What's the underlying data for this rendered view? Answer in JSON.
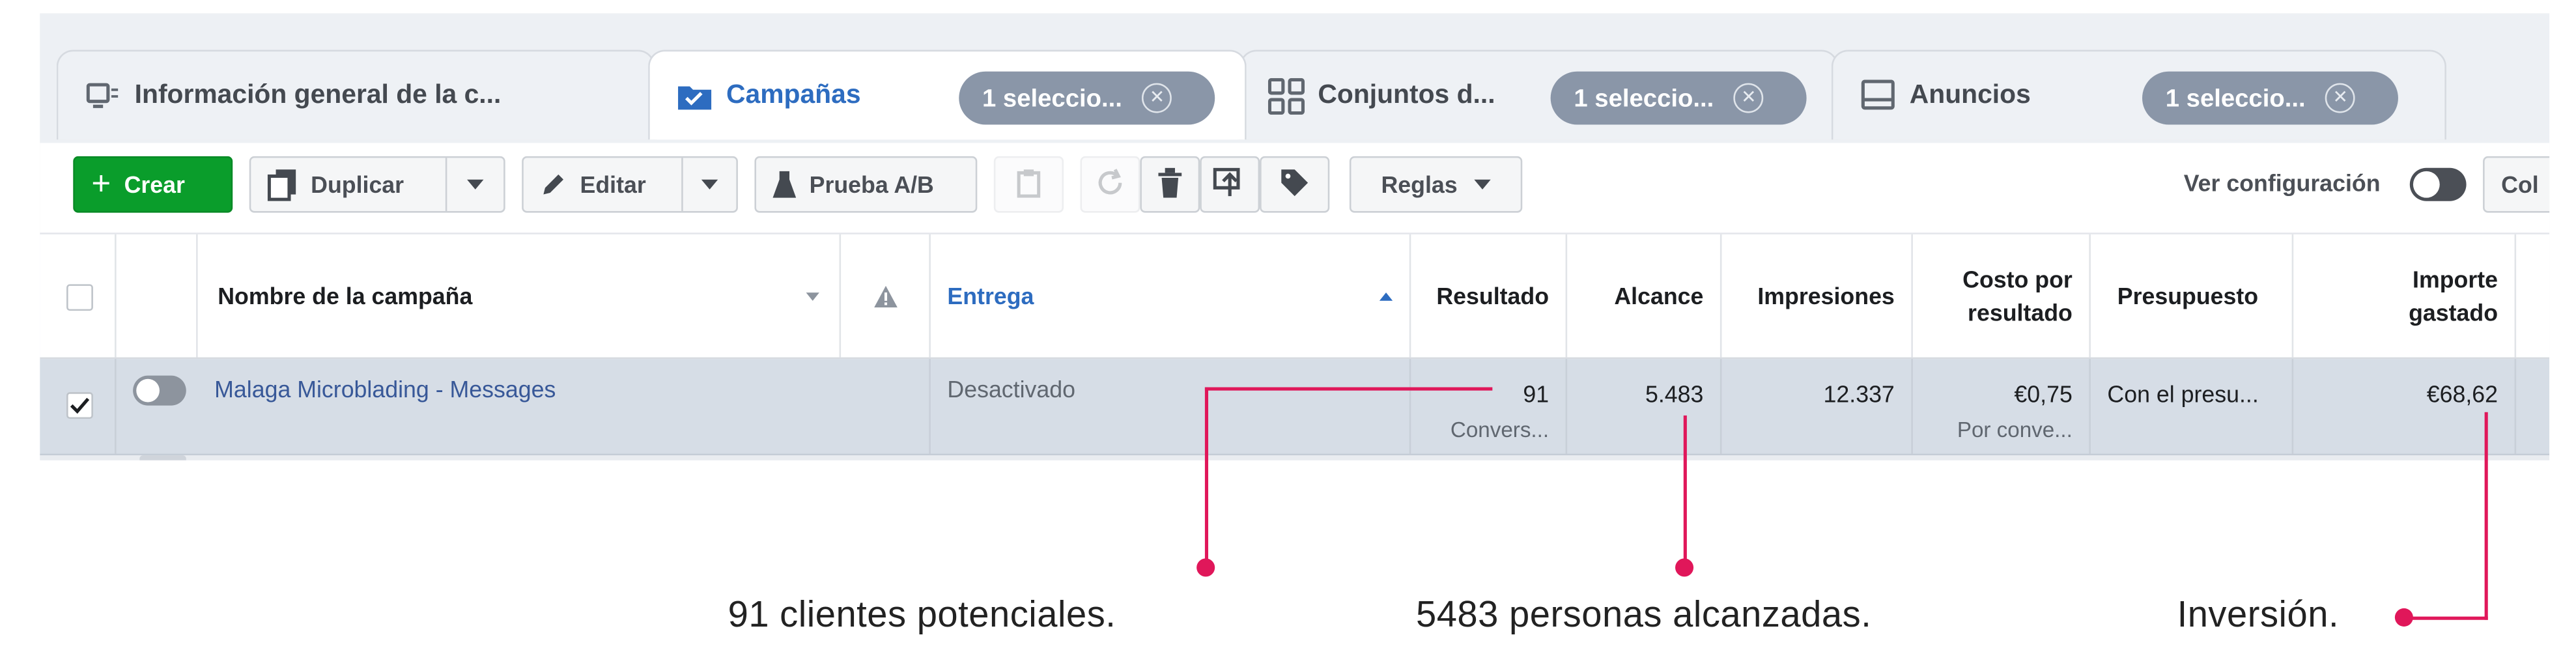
{
  "tabs": [
    {
      "label": "Información general de la c...",
      "icon": "overview-icon"
    },
    {
      "label": "Campañas",
      "icon": "folder-icon",
      "selection": "1 seleccio..."
    },
    {
      "label": "Conjuntos d...",
      "icon": "grid-icon",
      "selection": "1 seleccio..."
    },
    {
      "label": "Anuncios",
      "icon": "ad-icon",
      "selection": "1 seleccio..."
    }
  ],
  "toolbar": {
    "create": "Crear",
    "duplicate": "Duplicar",
    "edit": "Editar",
    "ab_test": "Prueba A/B",
    "rules": "Reglas",
    "view_settings": "Ver configuración",
    "columns": "Col"
  },
  "table": {
    "headers": {
      "name": "Nombre de la campaña",
      "delivery": "Entrega",
      "result": "Resultado",
      "reach": "Alcance",
      "impressions": "Impresiones",
      "cost_per_result_1": "Costo por",
      "cost_per_result_2": "resultado",
      "budget": "Presupuesto",
      "amount_spent_1": "Importe",
      "amount_spent_2": "gastado"
    },
    "rows": [
      {
        "name": "Malaga Microblading - Messages",
        "delivery": "Desactivado",
        "result": "91",
        "result_sub": "Convers...",
        "reach": "5.483",
        "impressions": "12.337",
        "cost": "€0,75",
        "cost_sub": "Por conve...",
        "budget": "Con el presu...",
        "spent": "€68,62"
      }
    ]
  },
  "annotations": {
    "leads": "91 clientes potenciales.",
    "reach": "5483 personas alcanzadas.",
    "investment": "Inversión."
  },
  "colors": {
    "accent": "#e0175a",
    "primary_button": "#0a9d2b",
    "link": "#385898",
    "active_tab": "#2d6cc0"
  }
}
